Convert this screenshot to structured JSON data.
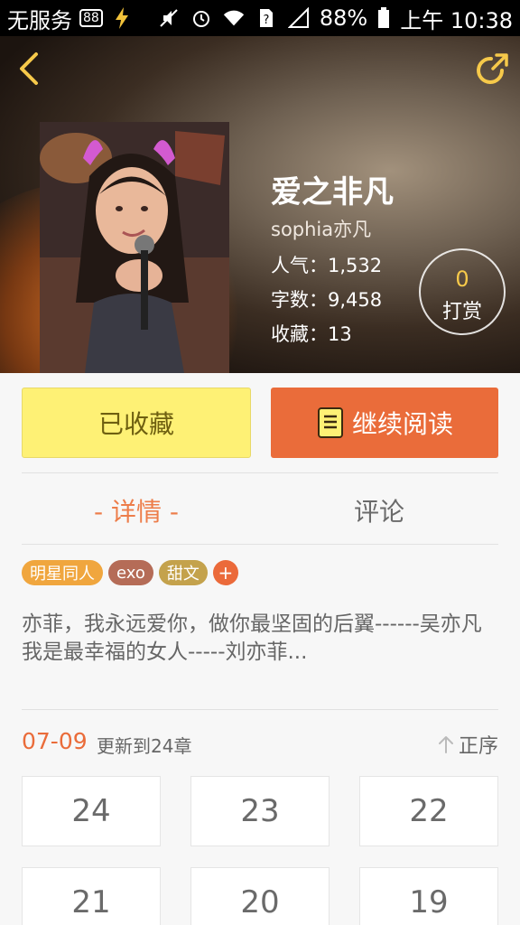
{
  "status_bar": {
    "carrier": "无服务",
    "badge": "88",
    "battery": "88%",
    "time": "上午 10:38",
    "icons": [
      "charging-icon",
      "mute-icon",
      "alarm-icon",
      "wifi-icon",
      "sim-unknown-icon",
      "signal-icon",
      "battery-icon"
    ]
  },
  "book": {
    "title": "爱之非凡",
    "author": "sophia亦凡",
    "popularity": "人气：1,532",
    "word_count": "字数：9,458",
    "favorites": "收藏：13",
    "reward_count": "0",
    "reward_label": "打赏"
  },
  "actions": {
    "favorited_label": "已收藏",
    "continue_label": "继续阅读"
  },
  "tabs": {
    "detail": "- 详情 -",
    "comment": "评论"
  },
  "tags": [
    "明星同人",
    "exo",
    "甜文"
  ],
  "tag_add": "+",
  "description": {
    "line1": "亦菲，我永远爱你，做你最坚固的后翼------吴亦凡",
    "line2": "我是最幸福的女人-----刘亦菲..."
  },
  "update": {
    "date": "07-09",
    "text": "更新到24章",
    "sort_label": "正序"
  },
  "chapters": [
    "24",
    "23",
    "22",
    "21",
    "20",
    "19"
  ],
  "colors": {
    "accent": "#ea6c3a",
    "favorite_button": "#fef175",
    "reward_count": "#f6c94a"
  }
}
